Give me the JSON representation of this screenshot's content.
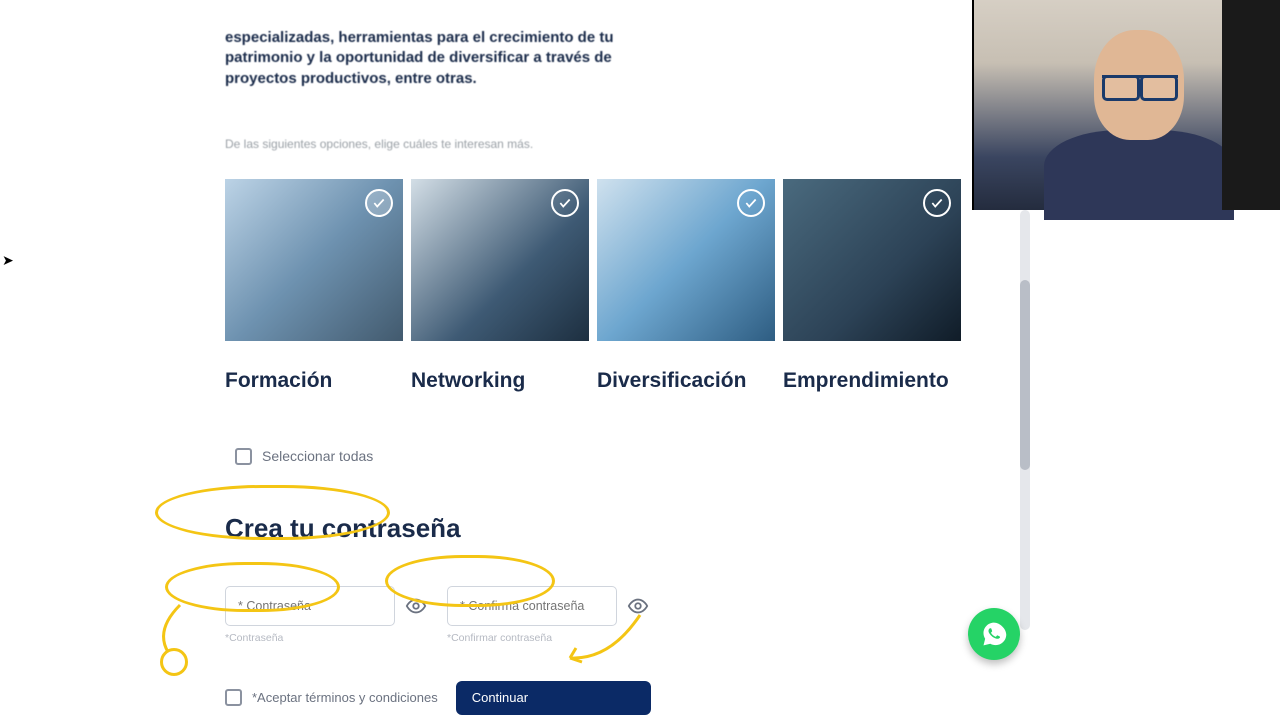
{
  "intro_lines": [
    "especializadas, herramientas para el crecimiento de tu",
    "patrimonio y la oportunidad de diversificar a través de",
    "proyectos productivos, entre otras."
  ],
  "instruction": "De las siguientes opciones, elige cuáles te interesan más.",
  "cards": [
    {
      "label": "Formación",
      "selected": true
    },
    {
      "label": "Networking",
      "selected": false
    },
    {
      "label": "Diversificación",
      "selected": false
    },
    {
      "label": "Emprendimiento",
      "selected": false
    }
  ],
  "select_all_label": "Seleccionar todas",
  "password_section": {
    "heading": "Crea tu contraseña",
    "password_placeholder": "* Contraseña",
    "password_hint": "*Contraseña",
    "confirm_placeholder": "* Confirma contraseña",
    "confirm_hint": "*Confirmar contraseña"
  },
  "terms_label": "*Aceptar términos y condiciones",
  "continue_label": "Continuar",
  "icons": {
    "check": "check-icon",
    "eye": "eye-icon",
    "whatsapp": "whatsapp-icon"
  },
  "colors": {
    "accent_dark": "#0b2a66",
    "annotation": "#f4c514",
    "whatsapp": "#25d366"
  }
}
